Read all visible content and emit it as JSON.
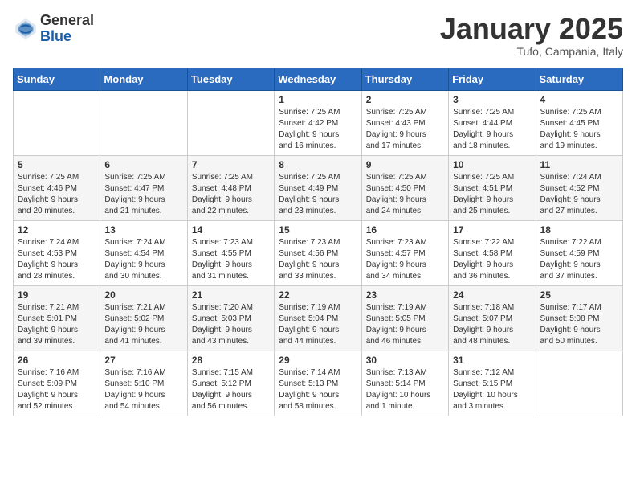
{
  "header": {
    "logo_general": "General",
    "logo_blue": "Blue",
    "month_title": "January 2025",
    "location": "Tufo, Campania, Italy"
  },
  "weekdays": [
    "Sunday",
    "Monday",
    "Tuesday",
    "Wednesday",
    "Thursday",
    "Friday",
    "Saturday"
  ],
  "weeks": [
    [
      {
        "day": "",
        "info": ""
      },
      {
        "day": "",
        "info": ""
      },
      {
        "day": "",
        "info": ""
      },
      {
        "day": "1",
        "info": "Sunrise: 7:25 AM\nSunset: 4:42 PM\nDaylight: 9 hours\nand 16 minutes."
      },
      {
        "day": "2",
        "info": "Sunrise: 7:25 AM\nSunset: 4:43 PM\nDaylight: 9 hours\nand 17 minutes."
      },
      {
        "day": "3",
        "info": "Sunrise: 7:25 AM\nSunset: 4:44 PM\nDaylight: 9 hours\nand 18 minutes."
      },
      {
        "day": "4",
        "info": "Sunrise: 7:25 AM\nSunset: 4:45 PM\nDaylight: 9 hours\nand 19 minutes."
      }
    ],
    [
      {
        "day": "5",
        "info": "Sunrise: 7:25 AM\nSunset: 4:46 PM\nDaylight: 9 hours\nand 20 minutes."
      },
      {
        "day": "6",
        "info": "Sunrise: 7:25 AM\nSunset: 4:47 PM\nDaylight: 9 hours\nand 21 minutes."
      },
      {
        "day": "7",
        "info": "Sunrise: 7:25 AM\nSunset: 4:48 PM\nDaylight: 9 hours\nand 22 minutes."
      },
      {
        "day": "8",
        "info": "Sunrise: 7:25 AM\nSunset: 4:49 PM\nDaylight: 9 hours\nand 23 minutes."
      },
      {
        "day": "9",
        "info": "Sunrise: 7:25 AM\nSunset: 4:50 PM\nDaylight: 9 hours\nand 24 minutes."
      },
      {
        "day": "10",
        "info": "Sunrise: 7:25 AM\nSunset: 4:51 PM\nDaylight: 9 hours\nand 25 minutes."
      },
      {
        "day": "11",
        "info": "Sunrise: 7:24 AM\nSunset: 4:52 PM\nDaylight: 9 hours\nand 27 minutes."
      }
    ],
    [
      {
        "day": "12",
        "info": "Sunrise: 7:24 AM\nSunset: 4:53 PM\nDaylight: 9 hours\nand 28 minutes."
      },
      {
        "day": "13",
        "info": "Sunrise: 7:24 AM\nSunset: 4:54 PM\nDaylight: 9 hours\nand 30 minutes."
      },
      {
        "day": "14",
        "info": "Sunrise: 7:23 AM\nSunset: 4:55 PM\nDaylight: 9 hours\nand 31 minutes."
      },
      {
        "day": "15",
        "info": "Sunrise: 7:23 AM\nSunset: 4:56 PM\nDaylight: 9 hours\nand 33 minutes."
      },
      {
        "day": "16",
        "info": "Sunrise: 7:23 AM\nSunset: 4:57 PM\nDaylight: 9 hours\nand 34 minutes."
      },
      {
        "day": "17",
        "info": "Sunrise: 7:22 AM\nSunset: 4:58 PM\nDaylight: 9 hours\nand 36 minutes."
      },
      {
        "day": "18",
        "info": "Sunrise: 7:22 AM\nSunset: 4:59 PM\nDaylight: 9 hours\nand 37 minutes."
      }
    ],
    [
      {
        "day": "19",
        "info": "Sunrise: 7:21 AM\nSunset: 5:01 PM\nDaylight: 9 hours\nand 39 minutes."
      },
      {
        "day": "20",
        "info": "Sunrise: 7:21 AM\nSunset: 5:02 PM\nDaylight: 9 hours\nand 41 minutes."
      },
      {
        "day": "21",
        "info": "Sunrise: 7:20 AM\nSunset: 5:03 PM\nDaylight: 9 hours\nand 43 minutes."
      },
      {
        "day": "22",
        "info": "Sunrise: 7:19 AM\nSunset: 5:04 PM\nDaylight: 9 hours\nand 44 minutes."
      },
      {
        "day": "23",
        "info": "Sunrise: 7:19 AM\nSunset: 5:05 PM\nDaylight: 9 hours\nand 46 minutes."
      },
      {
        "day": "24",
        "info": "Sunrise: 7:18 AM\nSunset: 5:07 PM\nDaylight: 9 hours\nand 48 minutes."
      },
      {
        "day": "25",
        "info": "Sunrise: 7:17 AM\nSunset: 5:08 PM\nDaylight: 9 hours\nand 50 minutes."
      }
    ],
    [
      {
        "day": "26",
        "info": "Sunrise: 7:16 AM\nSunset: 5:09 PM\nDaylight: 9 hours\nand 52 minutes."
      },
      {
        "day": "27",
        "info": "Sunrise: 7:16 AM\nSunset: 5:10 PM\nDaylight: 9 hours\nand 54 minutes."
      },
      {
        "day": "28",
        "info": "Sunrise: 7:15 AM\nSunset: 5:12 PM\nDaylight: 9 hours\nand 56 minutes."
      },
      {
        "day": "29",
        "info": "Sunrise: 7:14 AM\nSunset: 5:13 PM\nDaylight: 9 hours\nand 58 minutes."
      },
      {
        "day": "30",
        "info": "Sunrise: 7:13 AM\nSunset: 5:14 PM\nDaylight: 10 hours\nand 1 minute."
      },
      {
        "day": "31",
        "info": "Sunrise: 7:12 AM\nSunset: 5:15 PM\nDaylight: 10 hours\nand 3 minutes."
      },
      {
        "day": "",
        "info": ""
      }
    ]
  ]
}
